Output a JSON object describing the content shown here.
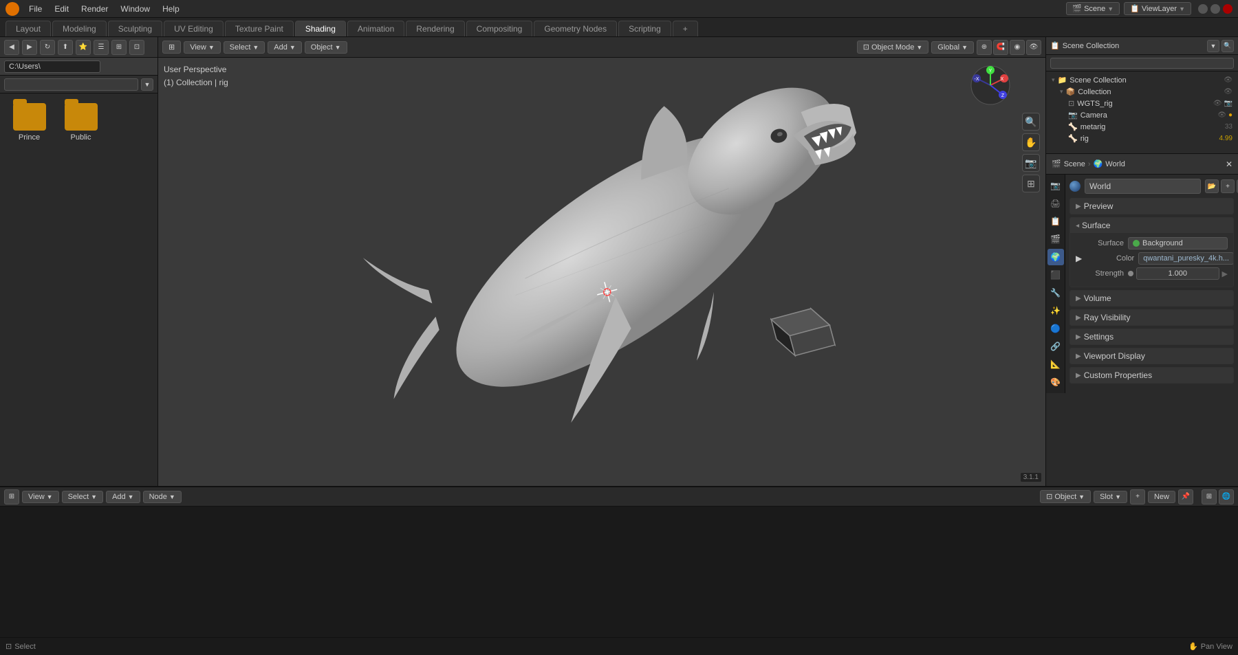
{
  "app": {
    "title": "Blender",
    "version": "3.1.1"
  },
  "topMenu": {
    "items": [
      "Blender",
      "File",
      "Edit",
      "Render",
      "Window",
      "Help"
    ]
  },
  "workspaceTabs": {
    "items": [
      "Layout",
      "Modeling",
      "Sculpting",
      "UV Editing",
      "Texture Paint",
      "Shading",
      "Animation",
      "Rendering",
      "Compositing",
      "Geometry Nodes",
      "Scripting",
      "+"
    ],
    "active": "Shading"
  },
  "header": {
    "viewLayer": "ViewLayer",
    "scene": "Scene",
    "icon": "🎬"
  },
  "leftSidebar": {
    "path": "C:\\Users\\",
    "folders": [
      {
        "name": "Prince",
        "type": "folder"
      },
      {
        "name": "Public",
        "type": "folder"
      }
    ]
  },
  "viewport": {
    "mode": "Object Mode",
    "perspective": "User Perspective",
    "collection": "(1) Collection | rig",
    "overlayLabel": "User Perspective",
    "collectionLabel": "(1) Collection | rig"
  },
  "outliner": {
    "title": "Scene Collection",
    "items": [
      {
        "name": "Scene Collection",
        "type": "scene",
        "level": 0
      },
      {
        "name": "Collection",
        "type": "collection",
        "level": 1
      },
      {
        "name": "WGTS_rig",
        "type": "mesh",
        "level": 2
      },
      {
        "name": "Camera",
        "type": "camera",
        "level": 2
      },
      {
        "name": "metarig",
        "type": "armature",
        "level": 2
      },
      {
        "name": "rig",
        "type": "armature",
        "level": 2
      }
    ]
  },
  "properties": {
    "breadcrumb": {
      "scene": "Scene",
      "world": "World"
    },
    "worldName": "World",
    "sections": {
      "preview": {
        "label": "Preview",
        "open": false
      },
      "surface": {
        "label": "Surface",
        "open": true,
        "surfaceType": "Background",
        "colorNode": "qwantani_puresky_4k.h...",
        "strength": "1.000"
      },
      "volume": {
        "label": "Volume",
        "open": false
      },
      "rayVisibility": {
        "label": "Ray Visibility",
        "open": false
      },
      "settings": {
        "label": "Settings",
        "open": false
      },
      "viewportDisplay": {
        "label": "Viewport Display",
        "open": false
      },
      "customProperties": {
        "label": "Custom Properties",
        "open": false
      }
    }
  },
  "propIcons": [
    {
      "icon": "🎬",
      "name": "scene-icon",
      "active": false
    },
    {
      "icon": "🌍",
      "name": "world-icon",
      "active": true
    },
    {
      "icon": "🎭",
      "name": "object-icon",
      "active": false
    },
    {
      "icon": "✏️",
      "name": "modifier-icon",
      "active": false
    },
    {
      "icon": "🔴",
      "name": "particles-icon",
      "active": false
    },
    {
      "icon": "💙",
      "name": "physics-icon",
      "active": false
    },
    {
      "icon": "🟡",
      "name": "constraints-icon",
      "active": false
    },
    {
      "icon": "📐",
      "name": "data-icon",
      "active": false
    },
    {
      "icon": "🎨",
      "name": "material-icon",
      "active": false
    }
  ],
  "nodeEditor": {
    "type": "Object",
    "slot": "Slot",
    "newBtn": "New"
  },
  "bottomBar": {
    "select": "Select",
    "panView": "Pan View"
  }
}
